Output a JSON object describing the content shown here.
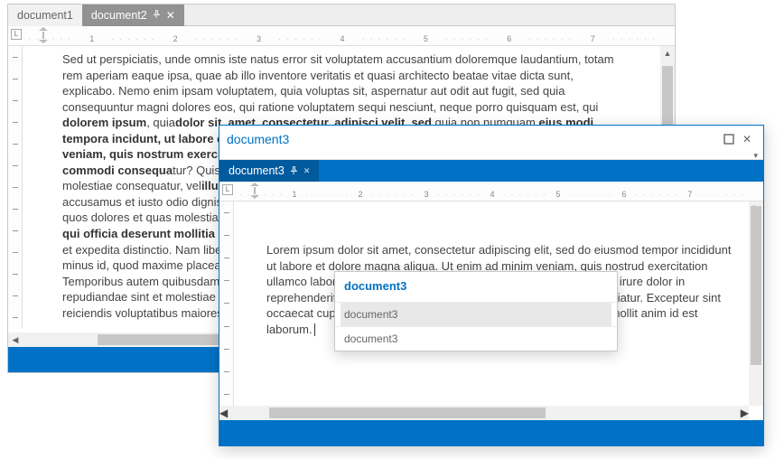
{
  "tabs": [
    {
      "label": "document1",
      "active": false
    },
    {
      "label": "document2",
      "active": true
    }
  ],
  "ruler_numbers": [
    "1",
    "2",
    "3",
    "4",
    "5",
    "6",
    "7"
  ],
  "doc2_parts": [
    {
      "t": "Sed ut perspiciatis, unde omnis iste natus error sit voluptatem accusantium doloremque laudantium, totam rem aperiam eaque ipsa, quae ab illo inventore veritatis et quasi architecto beatae vitae dicta sunt, explicabo. Nemo enim ipsam voluptatem, quia voluptas sit, aspernatur aut odit aut fugit, sed quia consequuntur magni dolores eos, qui ratione voluptatem sequi nesciunt, neque porro quisquam est, qui "
    },
    {
      "b": true,
      "t": "dolorem ipsum"
    },
    {
      "t": ", quia"
    },
    {
      "b": true,
      "t": "dolor sit, amet, consectetur, adipisci velit, sed"
    },
    {
      "t": " quia non numquam "
    },
    {
      "b": true,
      "t": "eius modi tempora incidunt, ut l"
    },
    {
      "b": true,
      "t": "abore et dolore magnam aliquam quaerat voluptatem. Ut enim ad minima veniam, quis nostrum exercitationem ullam corporis suscipit laboriosam, nisi ut aliquid ex ea commodi consequa"
    },
    {
      "t": "tur? Quis autem vel eum iure reprehenderit, qui in ea voluptate velit esse, quam nihil molestiae consequatur, vel"
    },
    {
      "b": true,
      "t": "illum, qui dolorem eum fugiat, quo voluptas nulla pariatur? At vero eos et "
    },
    {
      "t": "accusamus et iusto odio dignissimos ducimus, qui blanditiis praesentium voluptatum deleniti atque corrupti, quos dolores et quas molestias excepturi sint, obcaecati cupiditate non provident, similique sunt in "
    },
    {
      "b": true,
      "t": "culpa, qui officia deserunt mollitia animi, id est laborum et dolorum fuga."
    },
    {
      "t": " Et harum quidem rerum facilis est et expedita distinctio. Nam libero tempore, cum soluta nobis est eligendi optio, cumque nihil impedit, quo minus id, quod maxime placeat, facere possimus, omnis voluptas assumenda est, omnis dolor repellendus. Temporibus autem quibusdam et aut officiis debitis aut rerum necessitatibus saepe eveniet, ut et voluptates repudiandae sint et molestiae non recusandae. Itaque earum rerum hic tenetur a sapiente delectus, ut aut reiciendis voluptatibus maiores alias consequatur aut perferendis doloribus asperiores repellat."
    }
  ],
  "float": {
    "title": "document3",
    "tab_label": "document3",
    "ruler_numbers": [
      "1",
      "2",
      "3",
      "4",
      "5",
      "6",
      "7"
    ],
    "body": "Lorem ipsum dolor sit amet, consectetur adipiscing elit, sed do eiusmod tempor incididunt ut labore et dolore magna aliqua. Ut enim ad minim veniam, quis nostrud exercitation ullamco laboris nisi ut aliquip ex ea commodo consequat. Duis aute irure dolor in reprehenderit in voluptate velit esse cillum dolore eu fugiat nulla pariatur. Excepteur sint occaecat cupidatat non proident, sunt in culpa qui officia deserunt mollit anim id est laborum."
  },
  "switcher": {
    "title": "document3",
    "items": [
      "document3",
      "document3"
    ]
  }
}
